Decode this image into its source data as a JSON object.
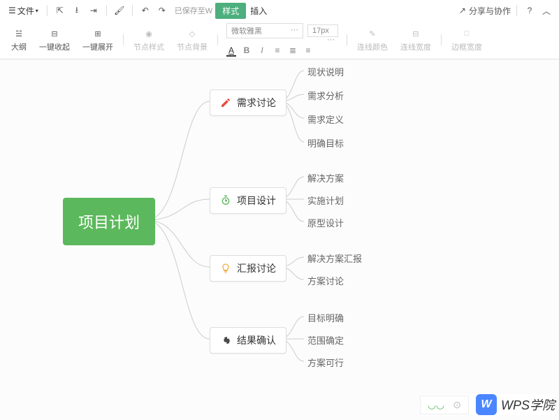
{
  "toolbar": {
    "menu_file": "文件",
    "saved_text": "已保存至W",
    "tab_style": "样式",
    "tab_insert": "插入",
    "share": "分享与协作",
    "outline": "大纲",
    "collapse": "一键收起",
    "expand": "一键展开",
    "node_style": "节点样式",
    "node_bg": "节点背景",
    "font_family": "微软雅黑",
    "font_size": "17px",
    "line_color": "连线颜色",
    "line_width": "连线宽度",
    "border_width": "边框宽度"
  },
  "mindmap": {
    "root": "项目计划",
    "branches": [
      {
        "icon": "pencil",
        "color": "#e74c3c",
        "label": "需求讨论",
        "leaves": [
          "现状说明",
          "需求分析",
          "需求定义",
          "明确目标"
        ]
      },
      {
        "icon": "clock",
        "color": "#5cb85c",
        "label": "项目设计",
        "leaves": [
          "解决方案",
          "实施计划",
          "原型设计"
        ]
      },
      {
        "icon": "bulb",
        "color": "#f0ad4e",
        "label": "汇报讨论",
        "leaves": [
          "解决方案汇报",
          "方案讨论"
        ]
      },
      {
        "icon": "gear",
        "color": "#333",
        "label": "结果确认",
        "leaves": [
          "目标明确",
          "范围确定",
          "方案可行"
        ]
      }
    ]
  },
  "watermark": "WPS学院"
}
